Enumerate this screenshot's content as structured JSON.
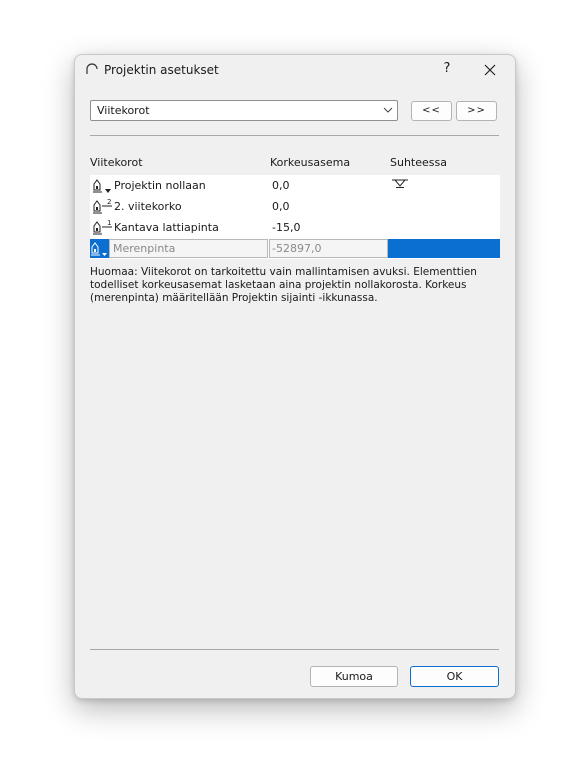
{
  "window": {
    "title": "Projektin asetukset",
    "help": "?"
  },
  "selector": {
    "value": "Viitekorot",
    "prev_label": "<<",
    "next_label": ">>"
  },
  "table": {
    "headers": [
      "Viitekorot",
      "Korkeusasema",
      "Suhteessa"
    ],
    "rows": [
      {
        "name": "Projektin nollaan",
        "elevation": "0,0",
        "icon": "project-zero-level-icon",
        "relative_icon": "zero-level-marker-icon"
      },
      {
        "name": "2. viitekorko",
        "elevation": "0,0",
        "icon": "reference-level-2-icon",
        "relative_icon": ""
      },
      {
        "name": "Kantava lattiapinta",
        "elevation": "-15,0",
        "icon": "reference-level-1-icon",
        "relative_icon": ""
      },
      {
        "name": "Merenpinta",
        "elevation": "-52897,0",
        "icon": "sea-level-icon",
        "relative_icon": "",
        "selected": true
      }
    ]
  },
  "note": "Huomaa: Viitekorot on tarkoitettu vain mallintamisen avuksi. Elementtien todelliset korkeusasemat lasketaan aina projektin nollakorosta. Korkeus (merenpinta) määritellään Projektin sijainti -ikkunassa.",
  "buttons": {
    "cancel": "Kumoa",
    "ok": "OK"
  },
  "colors": {
    "selection": "#0a6fd0",
    "dialog_bg": "#f0f0f0"
  }
}
